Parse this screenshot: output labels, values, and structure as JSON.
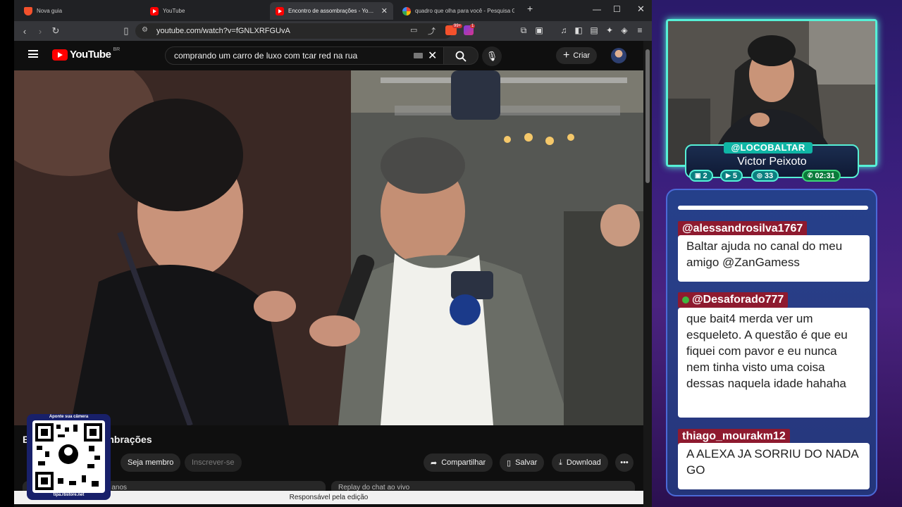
{
  "browser": {
    "tabs": [
      {
        "title": "Nova guia",
        "icon": "brave-icon"
      },
      {
        "title": "YouTube",
        "icon": "youtube-icon"
      },
      {
        "title": "Encontro de assombrações - YouTube",
        "icon": "youtube-icon",
        "active": true
      },
      {
        "title": "quadro que olha para você - Pesquisa Google",
        "icon": "google-icon"
      }
    ],
    "new_tab": "+",
    "url": "youtube.com/watch?v=fGNLXRFGUvA",
    "brave_badge": "99+",
    "rewards_badge": "1"
  },
  "youtube": {
    "logo": "YouTube",
    "country": "BR",
    "search_query": "comprando um carro de luxo com tcar red na rua",
    "create_label": "Criar",
    "video_title": "Encontro de assombrações",
    "join_label": "Seja membro",
    "subscribe_label": "Inscrever-se",
    "share_label": "Compartilhar",
    "save_label": "Salvar",
    "download_label": "Download",
    "desc_preview": "2 anos",
    "chat_replay": "Replay do chat ao vivo",
    "editor_note": "Responsável pela edição"
  },
  "qr": {
    "top_text": "Aponte sua câmera",
    "bottom_text": "tipa.rbstore.net"
  },
  "stream": {
    "handle": "@LOCOBALTAR",
    "name": "Victor Peixoto",
    "stats": [
      {
        "icon": "chat-icon",
        "value": "2"
      },
      {
        "icon": "video-icon",
        "value": "5"
      },
      {
        "icon": "link-icon",
        "value": "33"
      },
      {
        "icon": "whatsapp-icon",
        "value": "02:31"
      }
    ]
  },
  "chat": [
    {
      "user": "@alessandrosilva1767",
      "message": "Baltar ajuda no canal do meu amigo @ZanGamess"
    },
    {
      "user": "@Desaforado777",
      "message": "que bait4 merda ver um esqueleto. A questão é que eu fiquei com pavor e eu nunca nem tinha visto uma coisa dessas naquela idade hahaha"
    },
    {
      "user": "thiago_mourakm12",
      "message": "A ALEXA JA SORRIU DO NADA GO"
    }
  ]
}
